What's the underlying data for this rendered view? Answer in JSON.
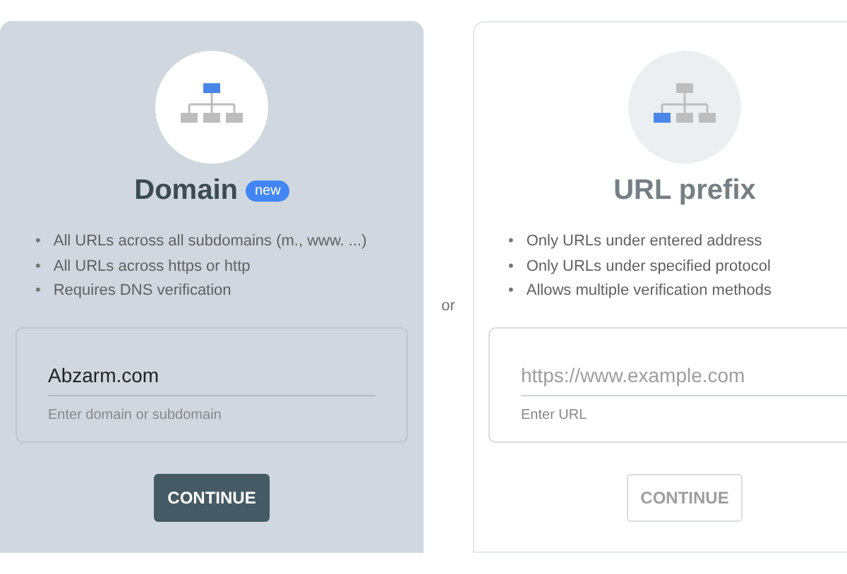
{
  "cards": [
    {
      "kind": "domain",
      "selected": true,
      "title": "Domain",
      "badge": "new",
      "bullets": [
        {
          "marker": "•",
          "text": "All URLs across all subdomains (m., www. ...)"
        },
        {
          "marker": "•",
          "text": "All URLs across https or http"
        },
        {
          "marker": "•",
          "text": "Requires DNS verification"
        }
      ],
      "field": {
        "value": "Abzarm.com",
        "helper": "Enter domain or subdomain"
      },
      "button": "CONTINUE"
    },
    {
      "kind": "url_prefix",
      "selected": false,
      "title": "URL prefix",
      "bullets": [
        {
          "marker": "•",
          "text": "Only URLs under entered address"
        },
        {
          "marker": "•",
          "text": "Only URLs under specified protocol"
        },
        {
          "marker": "•",
          "text": "Allows multiple verification methods"
        }
      ],
      "field": {
        "placeholder": "https://www.example.com",
        "helper": "Enter URL"
      },
      "button": "CONTINUE"
    }
  ],
  "separator": "or"
}
